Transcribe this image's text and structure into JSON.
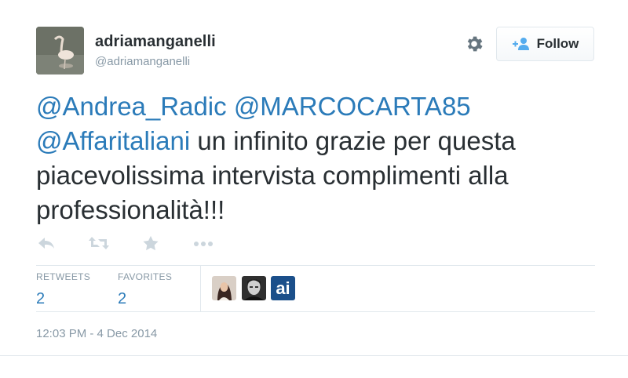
{
  "user": {
    "display_name": "adriamanganelli",
    "screen_name": "@adriamanganelli"
  },
  "follow": {
    "label": "Follow"
  },
  "tweet": {
    "mentions": [
      "@Andrea_Radic",
      "@MARCOCARTA85",
      "@Affaritaliani"
    ],
    "text": "un infinito grazie per questa piacevolissima intervista complimenti alla professionalità!!!"
  },
  "stats": {
    "retweets_label": "RETWEETS",
    "retweets_count": "2",
    "favorites_label": "FAVORITES",
    "favorites_count": "2"
  },
  "favoriters": {
    "third_label": "ai"
  },
  "timestamp": "12:03 PM - 4 Dec 2014",
  "icons": [
    "reply-icon",
    "retweet-icon",
    "favorite-icon",
    "more-icon",
    "gear-icon",
    "follow-person-icon"
  ],
  "colors": {
    "link": "#2b7bb9",
    "muted": "#8899a6",
    "text": "#292f33",
    "border": "#e1e8ed"
  }
}
